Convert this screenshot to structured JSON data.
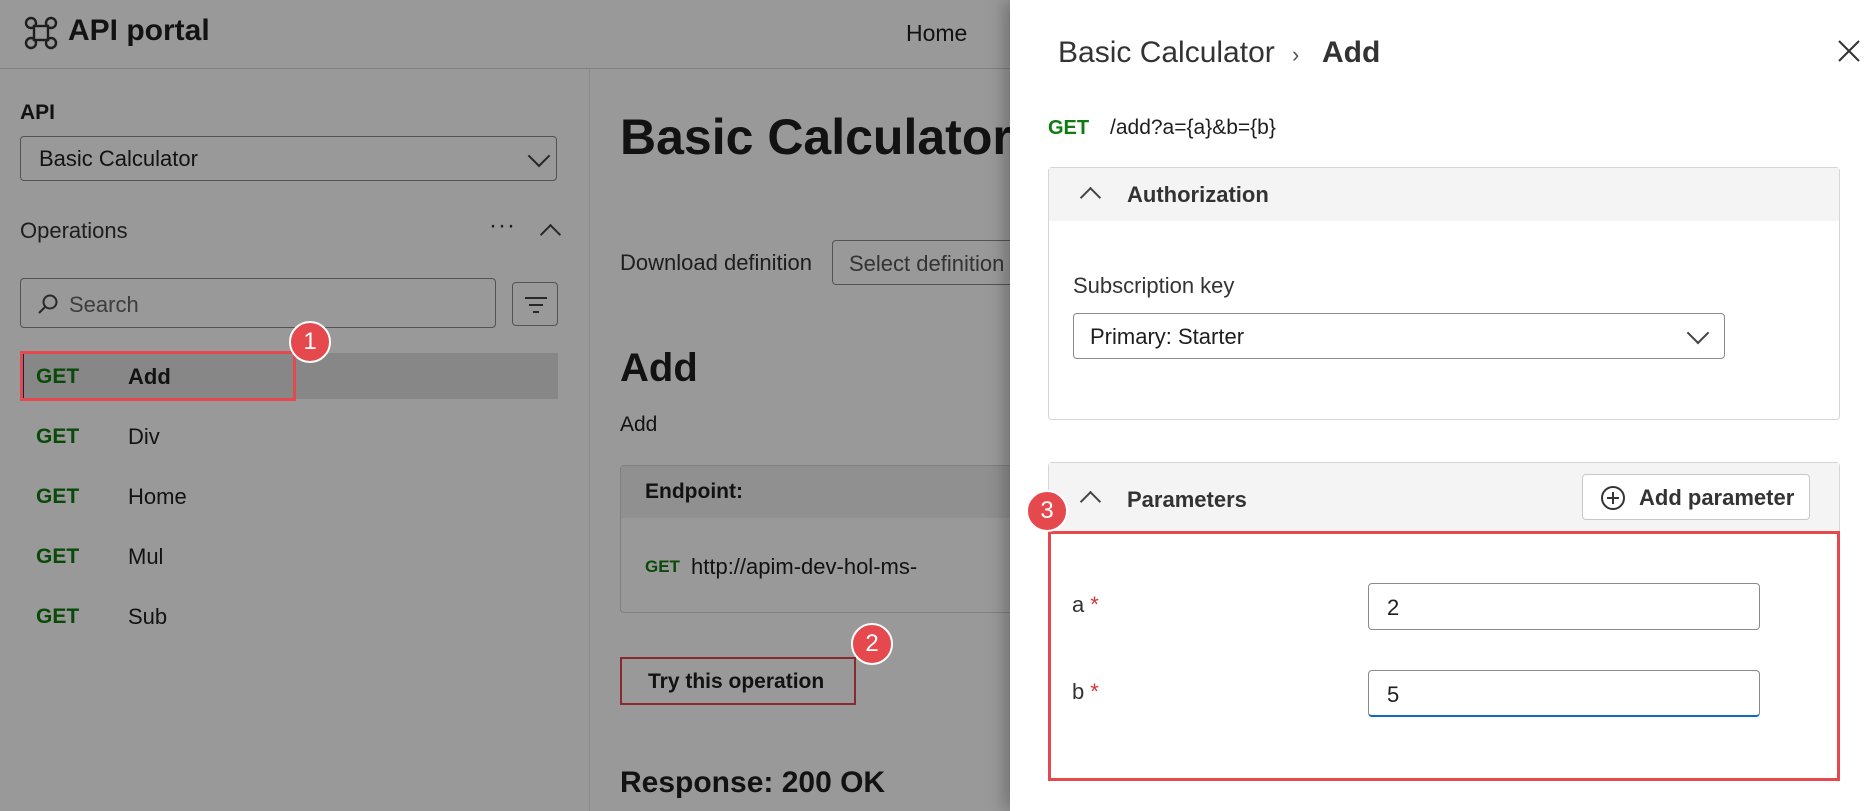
{
  "topbar": {
    "logo": "API portal",
    "nav_home": "Home"
  },
  "sidebar": {
    "api_label": "API",
    "api_selected": "Basic Calculator",
    "operations_label": "Operations",
    "more_label": "···",
    "search_placeholder": "Search",
    "operations": [
      {
        "method": "GET",
        "name": "Add",
        "active": true
      },
      {
        "method": "GET",
        "name": "Div"
      },
      {
        "method": "GET",
        "name": "Home"
      },
      {
        "method": "GET",
        "name": "Mul"
      },
      {
        "method": "GET",
        "name": "Sub"
      }
    ]
  },
  "main": {
    "title": "Basic Calculator",
    "download_label": "Download definition",
    "select_definition": "Select definition",
    "op_title": "Add",
    "op_desc": "Add",
    "endpoint_label": "Endpoint:",
    "endpoint_method": "GET",
    "endpoint_url": "http://apim-dev-hol-ms-",
    "try_button": "Try this operation",
    "response": "Response: 200 OK"
  },
  "badges": [
    "1",
    "2",
    "3"
  ],
  "panel": {
    "breadcrumb_api": "Basic Calculator",
    "breadcrumb_sep": "›",
    "breadcrumb_op": "Add",
    "method": "GET",
    "url": "/add?a={a}&b={b}",
    "auth_title": "Authorization",
    "subscription_label": "Subscription key",
    "subscription_value": "Primary: Starter",
    "params_title": "Parameters",
    "add_param": "Add parameter",
    "params": [
      {
        "name": "a",
        "required": "*",
        "value": "2"
      },
      {
        "name": "b",
        "required": "*",
        "value": "5"
      }
    ]
  },
  "colors": {
    "get_method": "#107c10",
    "highlight": "#e5484d",
    "active_bar": "#1f3b86",
    "focus": "#0f6cbd"
  }
}
